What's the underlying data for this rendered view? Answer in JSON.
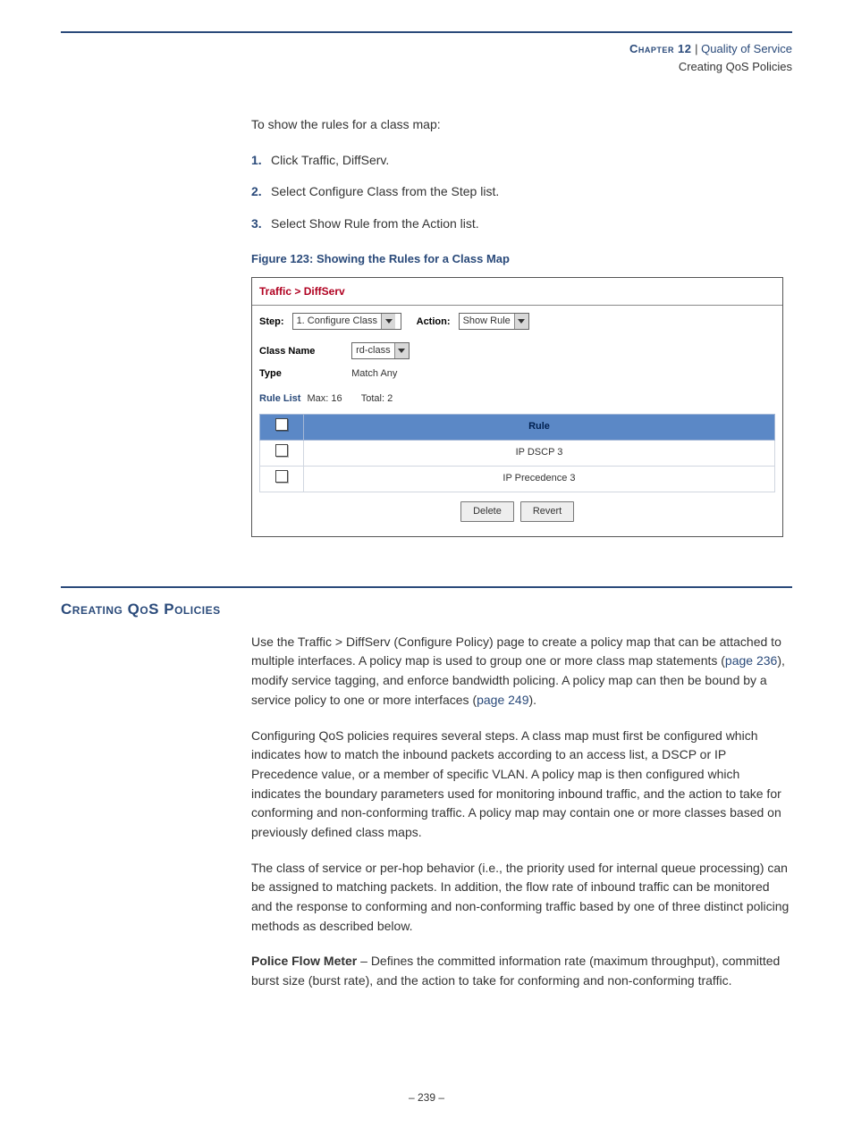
{
  "header": {
    "chapter_label": "Chapter 12",
    "pipe": "  |  ",
    "chapter_title": "Quality of Service",
    "subtitle": "Creating QoS Policies"
  },
  "intro": "To show the rules for a class map:",
  "steps": [
    {
      "n": "1.",
      "text": "Click Traffic, DiffServ."
    },
    {
      "n": "2.",
      "text": "Select Configure Class from the Step list."
    },
    {
      "n": "3.",
      "text": "Select Show Rule from the Action list."
    }
  ],
  "figure_caption": "Figure 123:  Showing the Rules for a Class Map",
  "screenshot": {
    "breadcrumb": "Traffic > DiffServ",
    "step_label": "Step:",
    "step_value": "1. Configure Class",
    "action_label": "Action:",
    "action_value": "Show Rule",
    "class_name_label": "Class Name",
    "class_name_value": "rd-class",
    "type_label": "Type",
    "type_value": "Match Any",
    "rule_list_label": "Rule List",
    "rule_list_max": "Max: 16",
    "rule_list_total": "Total: 2",
    "th_rule": "Rule",
    "rows": [
      {
        "rule": "IP DSCP 3"
      },
      {
        "rule": "IP Precedence 3"
      }
    ],
    "btn_delete": "Delete",
    "btn_revert": "Revert"
  },
  "section": {
    "heading": "Creating QoS Policies",
    "p1a": "Use the Traffic > DiffServ (Configure Policy) page to create a policy map that can be attached to multiple interfaces. A policy map is used to group one or more class map statements (",
    "p1_link1": "page 236",
    "p1b": "), modify service tagging, and enforce bandwidth policing. A policy map can then be bound by a service policy to one or more interfaces (",
    "p1_link2": "page 249",
    "p1c": ").",
    "p2": "Configuring QoS policies requires several steps. A class map must first be configured which indicates how to match the inbound packets according to an access list, a DSCP or IP Precedence value, or a member of specific VLAN. A policy map is then configured which indicates the boundary parameters used for monitoring inbound traffic, and the action to take for conforming and non-conforming traffic. A policy map may contain one or more classes based on previously defined class maps.",
    "p3": "The class of service or per-hop behavior (i.e., the priority used for internal queue processing) can be assigned to matching packets. In addition, the flow rate of inbound traffic can be monitored and the response to conforming and non-conforming traffic based by one of three distinct policing methods as described below.",
    "p4_bold": "Police Flow Meter",
    "p4_rest": " – Defines the committed information rate (maximum throughput), committed burst size (burst rate), and the action to take for conforming and non-conforming traffic."
  },
  "footer": {
    "dash1": "–  ",
    "page": "239",
    "dash2": "  –"
  }
}
